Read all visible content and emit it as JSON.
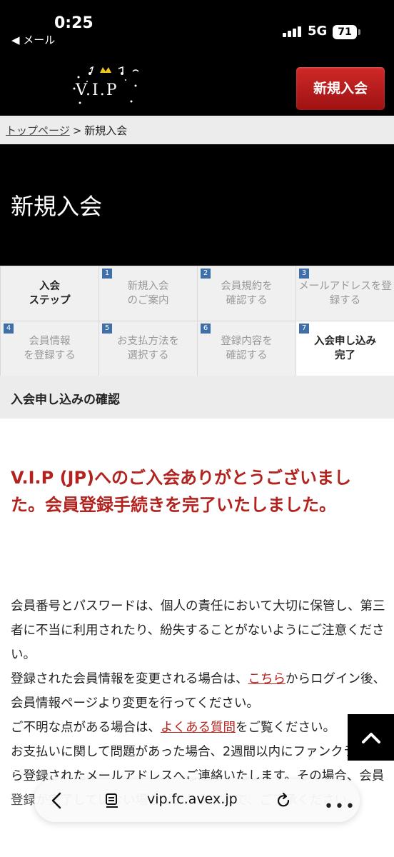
{
  "status_bar": {
    "time": "0:25",
    "back_app": "◀ メール",
    "network": "5G",
    "battery": "71"
  },
  "header": {
    "logo_text": "V.I.P",
    "join_button": "新規入会"
  },
  "breadcrumb": {
    "home": "トップページ",
    "separator": ">",
    "current": "新規入会"
  },
  "hero": {
    "title": "新規入会"
  },
  "steps": {
    "header_label_1": "入会",
    "header_label_2": "ステップ",
    "items": [
      {
        "num": "1",
        "line1": "新規入会",
        "line2": "のご案内"
      },
      {
        "num": "2",
        "line1": "会員規約を",
        "line2": "確認する"
      },
      {
        "num": "3",
        "line1": "メールアドレスを登",
        "line2": "録する"
      },
      {
        "num": "4",
        "line1": "会員情報",
        "line2": "を登録する"
      },
      {
        "num": "5",
        "line1": "お支払方法を",
        "line2": "選択する"
      },
      {
        "num": "6",
        "line1": "登録内容を",
        "line2": "確認する"
      },
      {
        "num": "7",
        "line1": "入会申し込み",
        "line2": "完了"
      }
    ],
    "current_step": 7
  },
  "confirm_title": "入会申し込みの確認",
  "thanks_message": "V.I.P (JP)へのご入会ありがとうございました。会員登録手続きを完了いたしました。",
  "body": {
    "p1": "会員番号とパスワードは、個人の責任において大切に保管し、第三者に不当に利用されたり、紛失することがないようにご注意ください。",
    "p2_before": "登録された会員情報を変更される場合は、",
    "p2_link": "こちら",
    "p2_after": "からログイン後、会員情報ページより変更を行ってください。",
    "p3_before": "ご不明な点がある場合は、",
    "p3_link": "よくある質問",
    "p3_after": "をご覧ください。",
    "p4": "お支払いに関して問題があった場合、2週間以内にファンクラブから登録されたメールアドレスへご連絡いたします。その場合、会員登録が完了していない場合がありますので、ご了承ください。"
  },
  "browser": {
    "url": "vip.fc.avex.jp"
  },
  "colors": {
    "accent_red": "#b2231f",
    "step_number_blue": "#3f6fa8"
  }
}
